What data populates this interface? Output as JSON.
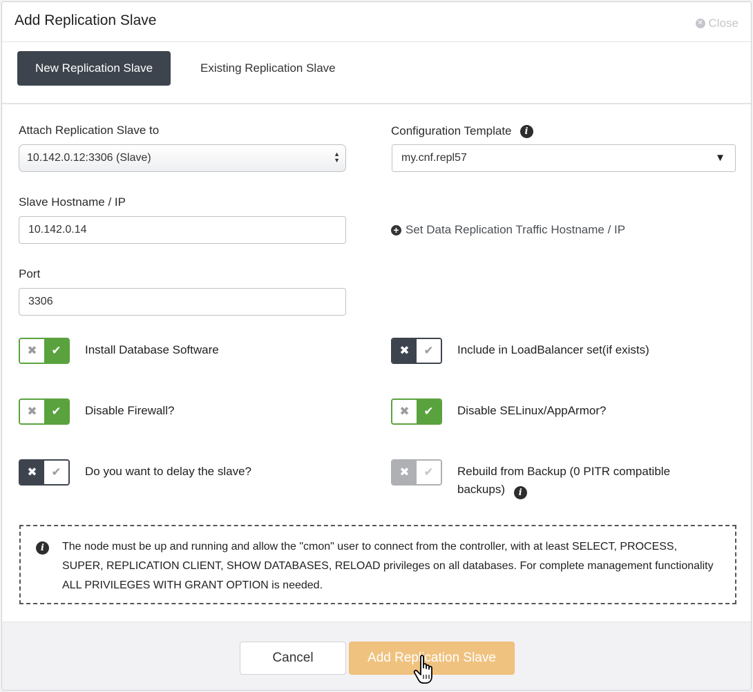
{
  "modal": {
    "title": "Add Replication Slave",
    "close_label": "Close",
    "close_glyph": "✕"
  },
  "tabs": [
    {
      "label": "New Replication Slave",
      "active": true
    },
    {
      "label": "Existing Replication Slave",
      "active": false
    }
  ],
  "form": {
    "attach_label": "Attach Replication Slave to",
    "attach_value": "10.142.0.12:3306 (Slave)",
    "config_label": "Configuration Template",
    "config_value": "my.cnf.repl57",
    "dropdown_arrow": "▼",
    "hostname_label": "Slave Hostname / IP",
    "hostname_value": "10.142.0.14",
    "traffic_link": "Set Data Replication Traffic Hostname / IP",
    "plus_glyph": "+",
    "port_label": "Port",
    "port_value": "3306",
    "info_glyph": "i"
  },
  "toggles": {
    "install_db": {
      "label": "Install Database Software",
      "state": "on"
    },
    "loadbalancer": {
      "label": "Include in LoadBalancer set(if exists)",
      "state": "off"
    },
    "firewall": {
      "label": "Disable Firewall?",
      "state": "on"
    },
    "selinux": {
      "label": "Disable SELinux/AppArmor?",
      "state": "on"
    },
    "delay": {
      "label": "Do you want to delay the slave?",
      "state": "off"
    },
    "rebuild": {
      "label": "Rebuild from Backup (0 PITR compatible backups)",
      "state": "disabled"
    },
    "x_glyph": "✖",
    "check_glyph": "✔"
  },
  "notice": {
    "text": "The node must be up and running and allow the \"cmon\" user to connect from the controller, with at least SELECT, PROCESS, SUPER, REPLICATION CLIENT, SHOW DATABASES, RELOAD privileges on all databases. For complete management functionality ALL PRIVILEGES WITH GRANT OPTION is needed."
  },
  "footer": {
    "cancel_label": "Cancel",
    "submit_label": "Add Replication Slave"
  },
  "colors": {
    "toggle_on": "#5aa23e",
    "toggle_off": "#3d444d",
    "toggle_disabled": "#aeb0b3",
    "primary_button": "#f0c27f",
    "active_tab": "#3d444d"
  }
}
